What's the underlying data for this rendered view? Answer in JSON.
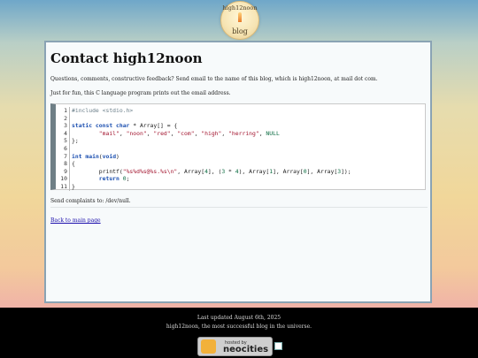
{
  "logo": {
    "top_text": "high12noon",
    "bottom_text": "blog"
  },
  "page": {
    "title": "Contact high12noon",
    "intro": "Questions, comments, constructive feedback? Send email to the name of this blog, which is high12noon, at mail dot com.",
    "fun": "Just for fun, this C language program prints out the email address.",
    "complaints": "Send complaints to: /dev/null.",
    "back_link": "Back to main page"
  },
  "code": {
    "lines": [
      {
        "n": "1",
        "html": "<span class='pp'>#include &lt;stdio.h&gt;</span>"
      },
      {
        "n": "2",
        "html": ""
      },
      {
        "n": "3",
        "html": "<span class='k'>static const char</span> * Array[] = {"
      },
      {
        "n": "4",
        "html": "        <span class='s'>\"mail\"</span>, <span class='s'>\"noon\"</span>, <span class='s'>\"red\"</span>, <span class='s'>\"com\"</span>, <span class='s'>\"high\"</span>, <span class='s'>\"herring\"</span>, <span class='n'>NULL</span>"
      },
      {
        "n": "5",
        "html": "};"
      },
      {
        "n": "6",
        "html": ""
      },
      {
        "n": "7",
        "html": "<span class='k'>int</span> <span class='k'>main</span>(<span class='k'>void</span>)"
      },
      {
        "n": "8",
        "html": "{"
      },
      {
        "n": "9",
        "html": "        printf(<span class='s'>\"%s%d%s@%s.%s\\n\"</span>, Array[<span class='n'>4</span>], (<span class='n'>3</span> * <span class='n'>4</span>), Array[<span class='n'>1</span>], Array[<span class='n'>0</span>], Array[<span class='n'>3</span>]);"
      },
      {
        "n": "10",
        "html": "        <span class='k'>return</span> <span class='n'>0</span>;"
      },
      {
        "n": "11",
        "html": "}"
      }
    ]
  },
  "footer": {
    "updated": "Last updated August 6th, 2025",
    "tagline": "high12noon, the most successful blog in the universe.",
    "badge_small": "hosted by",
    "badge_big": "neocities"
  }
}
